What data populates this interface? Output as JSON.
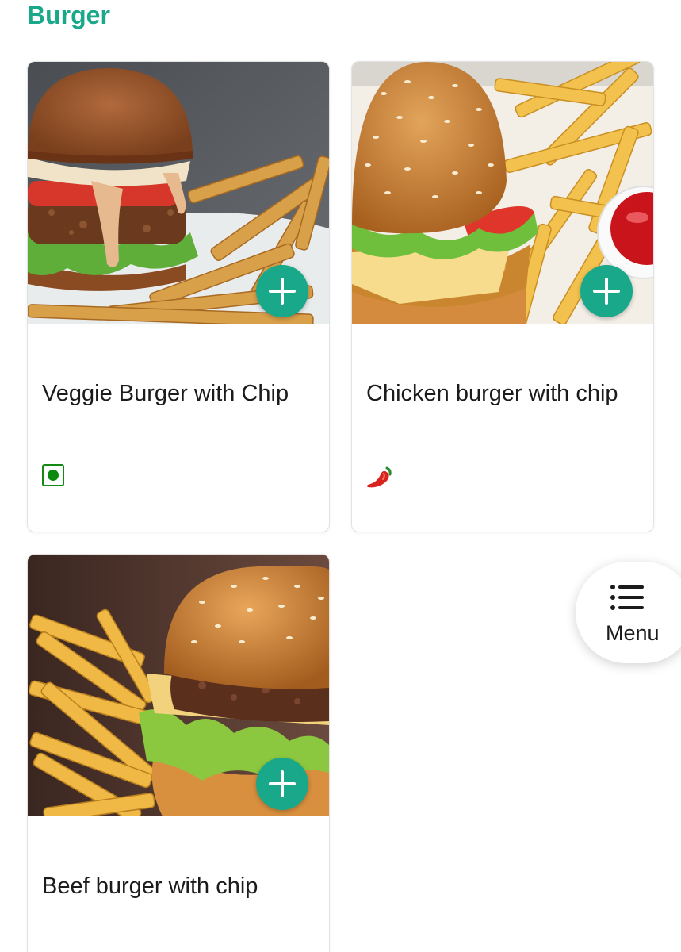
{
  "section": {
    "title": "Burger"
  },
  "items": [
    {
      "name": "Veggie Burger with Chip",
      "diet_icon": "veg-icon"
    },
    {
      "name": "Chicken burger with chip",
      "diet_icon": "chili-pepper-icon"
    },
    {
      "name": "Beef burger with chip",
      "diet_icon": ""
    }
  ],
  "menu_button": {
    "label": "Menu",
    "icon": "list-icon"
  },
  "colors": {
    "accent": "#1aa88a",
    "veg_green": "#0c8a0c",
    "text": "#1b1b1b"
  }
}
